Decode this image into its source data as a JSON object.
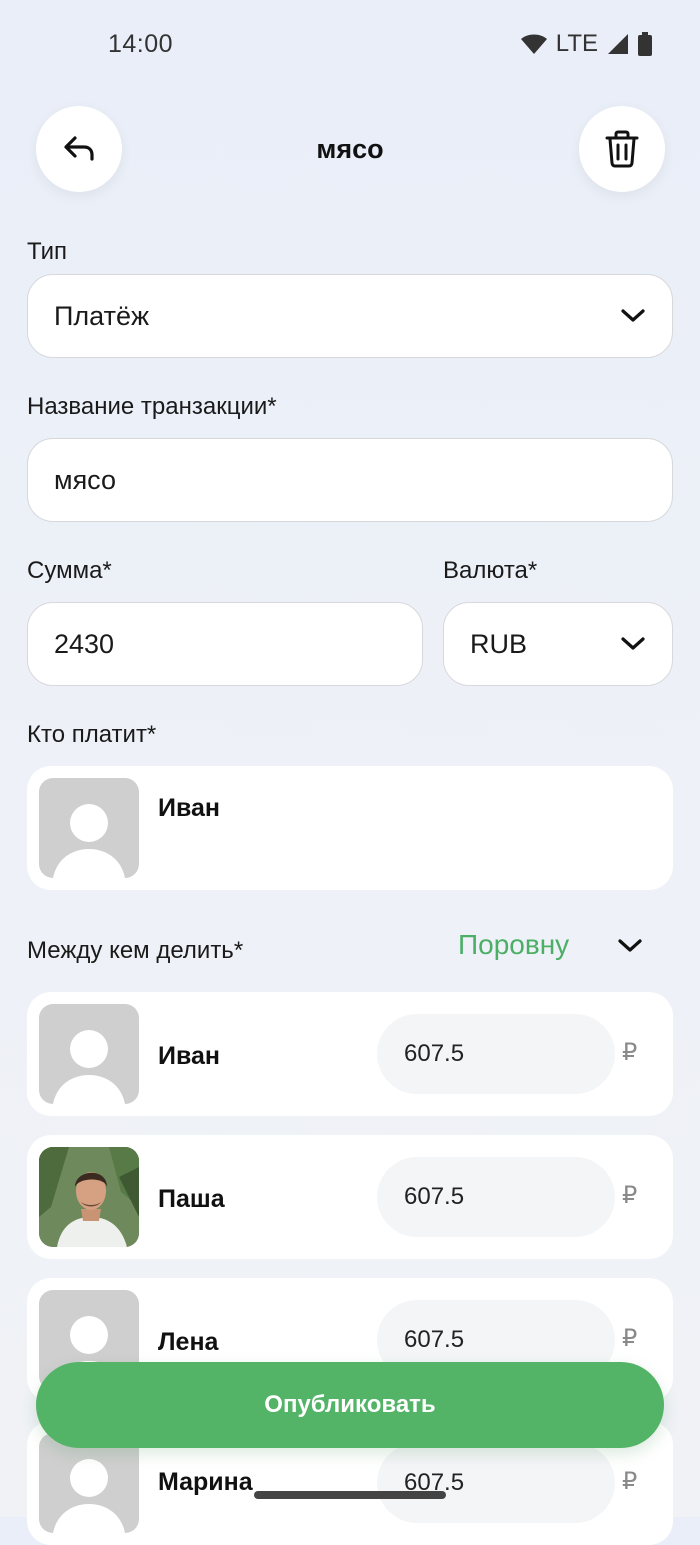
{
  "status_bar": {
    "time": "14:00",
    "network": "LTE"
  },
  "header": {
    "title": "мясо",
    "back_icon": "back-arrow-icon",
    "delete_icon": "trash-icon"
  },
  "type_field": {
    "label": "Тип",
    "value": "Платёж"
  },
  "name_field": {
    "label": "Название транзакции*",
    "value": "мясо"
  },
  "amount_field": {
    "label": "Сумма*",
    "value": "2430"
  },
  "currency_field": {
    "label": "Валюта*",
    "value": "RUB"
  },
  "payer": {
    "label": "Кто платит*",
    "name": "Иван"
  },
  "split": {
    "label": "Между кем делить*",
    "mode": "Поровну",
    "currency_symbol": "₽",
    "participants": [
      {
        "name": "Иван",
        "amount": "607.5"
      },
      {
        "name": "Паша",
        "amount": "607.5"
      },
      {
        "name": "Лена",
        "amount": "607.5"
      },
      {
        "name": "Марина",
        "amount": "607.5"
      }
    ]
  },
  "publish_button": {
    "label": "Опубликовать"
  },
  "colors": {
    "accent": "#53b366",
    "split_mode": "#4caf66",
    "background": "#e9eef8"
  }
}
